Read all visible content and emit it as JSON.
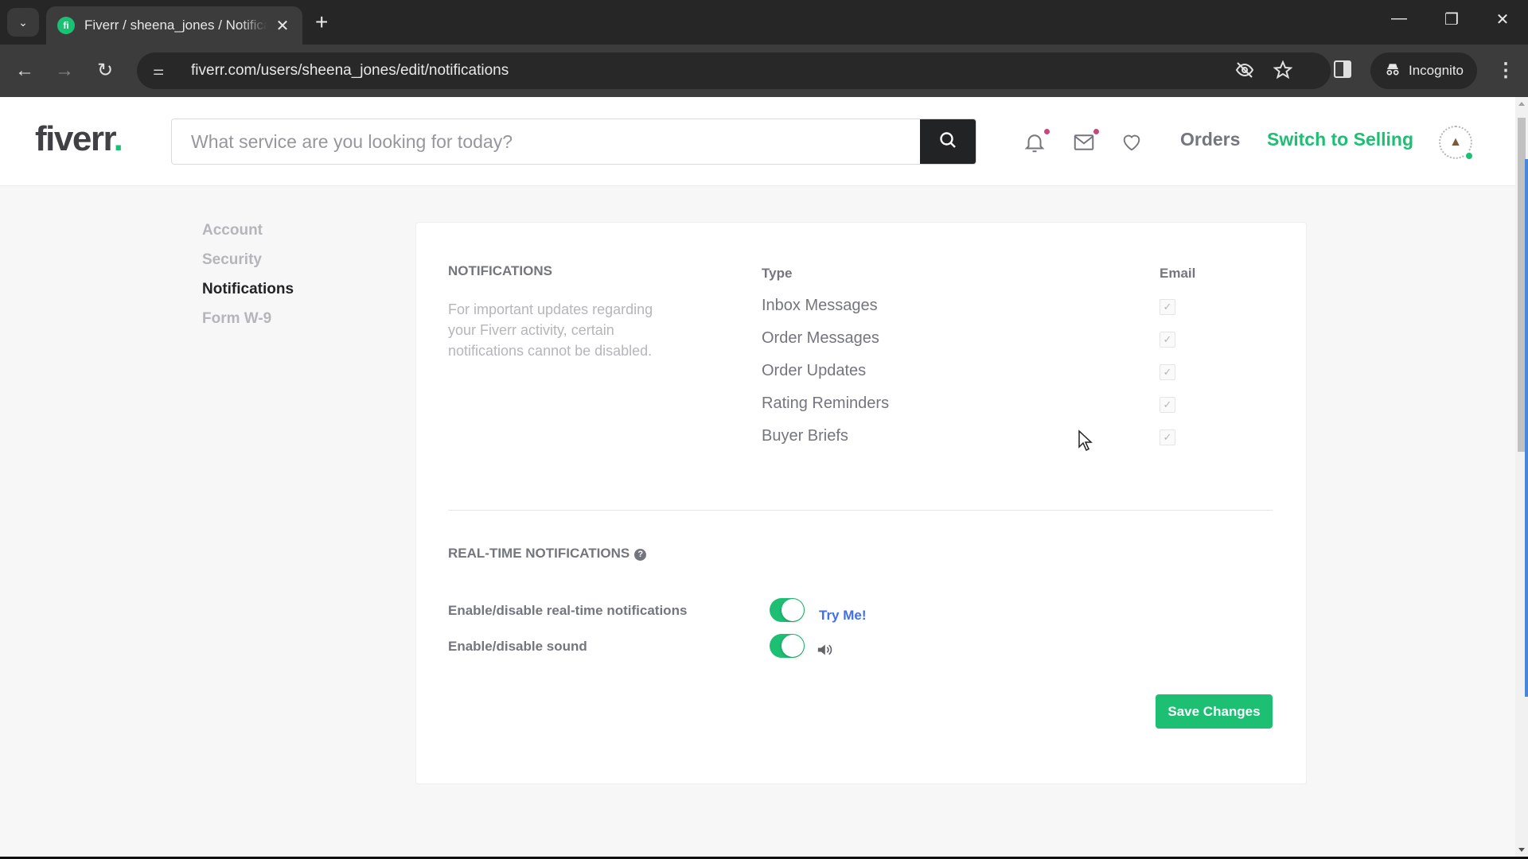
{
  "browser": {
    "tab_title": "Fiverr / sheena_jones / Notifications",
    "favicon_letter": "fi",
    "url": "fiverr.com/users/sheena_jones/edit/notifications",
    "incognito_label": "Incognito",
    "icons": {
      "tab_search": "chevron-down-icon",
      "close_tab": "close-icon",
      "new_tab": "plus-icon",
      "back": "arrow-left-icon",
      "forward": "arrow-right-icon",
      "reload": "reload-icon",
      "site_info": "tune-icon",
      "tracking": "eye-off-icon",
      "bookmark": "star-icon",
      "side_panel": "side-panel-icon",
      "incognito": "incognito-icon",
      "menu": "kebab-icon"
    },
    "glyphs": {
      "tab_search": "⌄",
      "close": "✕",
      "new_tab": "+",
      "minimize": "—",
      "restore": "❐",
      "close_window": "✕",
      "back": "←",
      "forward": "→",
      "reload": "↻",
      "site_info": "⚌",
      "eye_off": "◌",
      "star": "☆",
      "incognito": "🕵",
      "menu": "⋮"
    }
  },
  "header": {
    "logo_text": "fiverr",
    "logo_dot": ".",
    "search_placeholder": "What service are you looking for today?",
    "search_value": "",
    "notifications_badge": true,
    "messages_badge": true,
    "orders_label": "Orders",
    "switch_label": "Switch to Selling",
    "user_online": true
  },
  "sidebar": {
    "items": [
      {
        "label": "Account",
        "active": false
      },
      {
        "label": "Security",
        "active": false
      },
      {
        "label": "Notifications",
        "active": true
      },
      {
        "label": "Form W-9",
        "active": false
      }
    ]
  },
  "notifications": {
    "title": "NOTIFICATIONS",
    "description": "For important updates regarding your Fiverr activity, certain notifications cannot be disabled.",
    "type_header": "Type",
    "email_header": "Email",
    "rows": [
      {
        "type": "Inbox Messages",
        "email": true
      },
      {
        "type": "Order Messages",
        "email": true
      },
      {
        "type": "Order Updates",
        "email": true
      },
      {
        "type": "Rating Reminders",
        "email": true
      },
      {
        "type": "Buyer Briefs",
        "email": true
      }
    ],
    "check_glyph": "✓"
  },
  "realtime": {
    "title": "REAL-TIME NOTIFICATIONS",
    "help_glyph": "?",
    "items": [
      {
        "label": "Enable/disable real-time notifications",
        "enabled": true
      },
      {
        "label": "Enable/disable sound",
        "enabled": true
      }
    ],
    "try_me_label": "Try Me!",
    "sound_glyph": "🔊"
  },
  "actions": {
    "save_label": "Save Changes"
  },
  "colors": {
    "brand_green": "#1dbf73",
    "link_blue": "#446ee7",
    "badge_pink": "#c24a7b"
  }
}
